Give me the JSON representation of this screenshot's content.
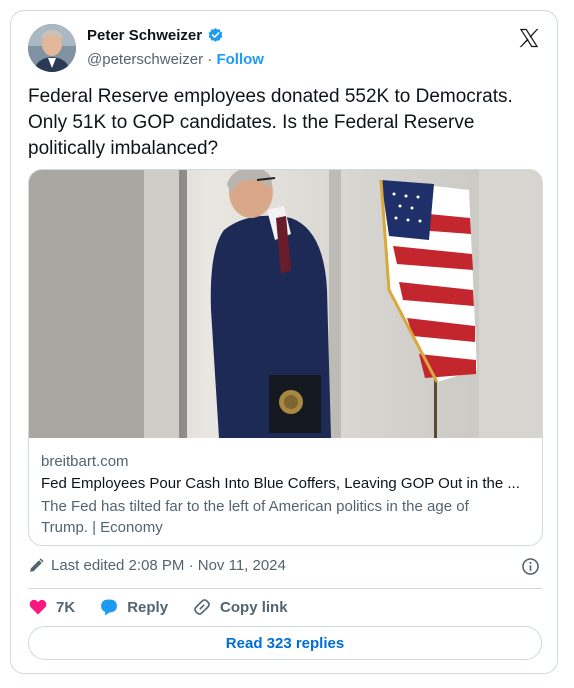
{
  "author": {
    "name": "Peter Schweizer",
    "handle": "@peterschweizer",
    "separator": "·",
    "follow_label": "Follow"
  },
  "tweet": {
    "text": "Federal Reserve employees donated 552K to Democrats. Only 51K to GOP candidates. Is the Federal Reserve politically imbalanced?"
  },
  "link_card": {
    "domain": "breitbart.com",
    "title": "Fed Employees Pour Cash Into Blue Coffers, Leaving GOP Out in the ...",
    "description": "The Fed has tilted far to the left of American politics in the age of Trump. | Economy"
  },
  "meta": {
    "edited": "Last edited 2:08 PM · Nov 11, 2024"
  },
  "actions": {
    "likes": "7K",
    "reply_label": "Reply",
    "copy_label": "Copy link"
  },
  "read_replies": "Read 323 replies",
  "colors": {
    "accent": "#1d9bf0",
    "like": "#f91880",
    "link_button": "#006fd6",
    "border": "#cfd9de",
    "muted": "#536471"
  },
  "icons": [
    "verified-icon",
    "x-logo-icon",
    "pencil-icon",
    "info-icon",
    "heart-icon",
    "reply-bubble-icon",
    "link-icon"
  ]
}
